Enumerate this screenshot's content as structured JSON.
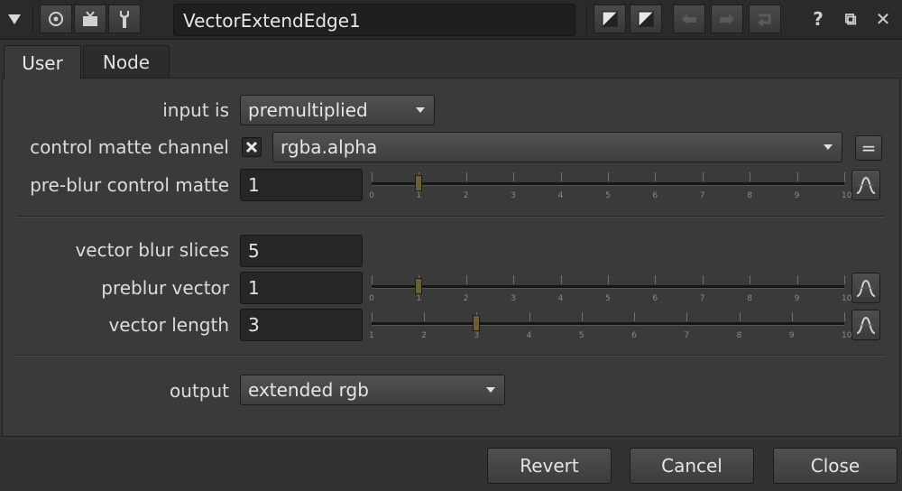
{
  "window": {
    "node_name": "VectorExtendEdge1",
    "help_label": "?",
    "float_label": "⧉",
    "close_label": "✕"
  },
  "tabs": [
    {
      "label": "User",
      "active": true
    },
    {
      "label": "Node",
      "active": false
    }
  ],
  "knobs": {
    "input_is": {
      "label": "input is",
      "value": "premultiplied"
    },
    "control_matte_channel": {
      "label": "control matte channel",
      "checked": true,
      "value": "rgba.alpha",
      "eq_label": "="
    },
    "preblur_control_matte": {
      "label": "pre-blur control matte",
      "value": "1",
      "slider_level": 1,
      "ticks": [
        "0",
        "1",
        "2",
        "3",
        "4",
        "5",
        "6",
        "7",
        "8",
        "9",
        "10"
      ]
    },
    "vector_blur_slices": {
      "label": "vector blur slices",
      "value": "5"
    },
    "preblur_vector": {
      "label": "preblur vector",
      "value": "1",
      "slider_level": 1,
      "ticks": [
        "0",
        "1",
        "2",
        "3",
        "4",
        "5",
        "6",
        "7",
        "8",
        "9",
        "10"
      ]
    },
    "vector_length": {
      "label": "vector length",
      "value": "3",
      "slider_level": 3,
      "ticks": [
        "1",
        "2",
        "3",
        "4",
        "5",
        "6",
        "7",
        "8",
        "9",
        "10"
      ]
    },
    "output": {
      "label": "output",
      "value": "extended rgb"
    }
  },
  "buttons": {
    "revert": "Revert",
    "cancel": "Cancel",
    "close": "Close"
  },
  "colors": {
    "background": "#323232",
    "panel": "#3a3a3a",
    "handle": "#6e5f33"
  }
}
